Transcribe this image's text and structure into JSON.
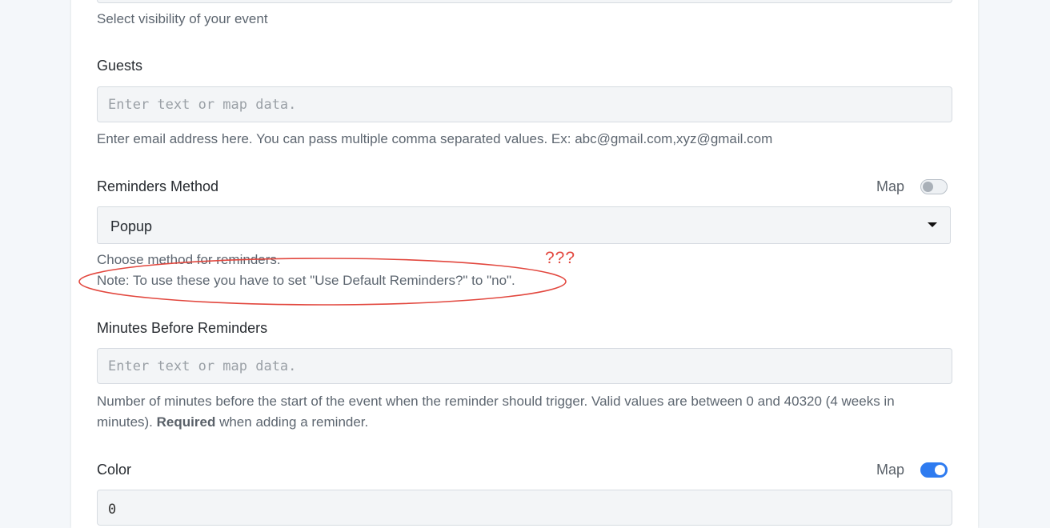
{
  "visibility": {
    "help": "Select visibility of your event"
  },
  "guests": {
    "label": "Guests",
    "placeholder": "Enter text or map data.",
    "help": "Enter email address here. You can pass multiple comma separated values. Ex: abc@gmail.com,xyz@gmail.com"
  },
  "reminders_method": {
    "label": "Reminders Method",
    "map_label": "Map",
    "map_enabled": false,
    "selected": "Popup",
    "help_line1": "Choose method for reminders.",
    "help_line2": "Note: To use these you have to set \"Use Default Reminders?\" to \"no\"."
  },
  "annotation": {
    "text": "???",
    "color": "#e2473e"
  },
  "minutes_before": {
    "label": "Minutes Before Reminders",
    "placeholder": "Enter text or map data.",
    "help_main": "Number of minutes before the start of the event when the reminder should trigger. Valid values are between 0 and 40320 (4 weeks in",
    "help_second": "minutes).",
    "help_bold": "Required",
    "help_tail": "when adding a reminder."
  },
  "color": {
    "label": "Color",
    "map_label": "Map",
    "map_enabled": true,
    "value": "0"
  },
  "theme": {
    "accent": "#2e7bf0",
    "annotation_red": "#e2473e"
  }
}
